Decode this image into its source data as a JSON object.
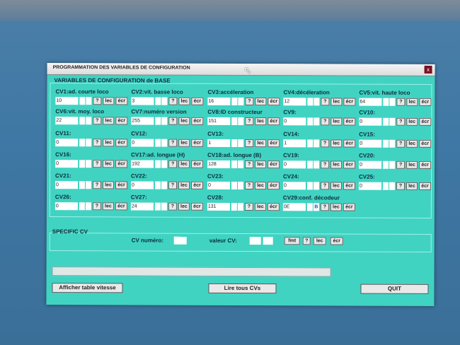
{
  "window": {
    "title": "PROGRAMMATION DES VARIABLES DE CONFIGURATION",
    "close_label": "x"
  },
  "base_section": {
    "title": "VARIABLES DE CONFIGURATION de BASE"
  },
  "buttons": {
    "q": "?",
    "lec": "lec",
    "ecr": "écr"
  },
  "cvs": [
    {
      "label": "CV1:ad. courte loco",
      "value": "10"
    },
    {
      "label": "CV2:vit. basse loco",
      "value": "3"
    },
    {
      "label": "CV3:accéleration",
      "value": "16"
    },
    {
      "label": "CV4:décéleration",
      "value": "12"
    },
    {
      "label": "CV5:vit. haute loco",
      "value": "64"
    },
    {
      "label": "CV6:vit. moy. loco",
      "value": "22"
    },
    {
      "label": "CV7:numéro version",
      "value": "255"
    },
    {
      "label": "CV8:ID constructeur",
      "value": "151"
    },
    {
      "label": "CV9:",
      "value": "0"
    },
    {
      "label": "CV10:",
      "value": "0"
    },
    {
      "label": "CV11:",
      "value": "0"
    },
    {
      "label": "CV12:",
      "value": "0"
    },
    {
      "label": "CV13:",
      "value": "1"
    },
    {
      "label": "CV14:",
      "value": "1"
    },
    {
      "label": "CV15:",
      "value": "0"
    },
    {
      "label": "CV16:",
      "value": "0"
    },
    {
      "label": "CV17:ad. longue (H)",
      "value": "192"
    },
    {
      "label": "CV18:ad. longue (B)",
      "value": "128"
    },
    {
      "label": "CV19:",
      "value": "0"
    },
    {
      "label": "CV20:",
      "value": "0"
    },
    {
      "label": "CV21:",
      "value": "0"
    },
    {
      "label": "CV22:",
      "value": "0"
    },
    {
      "label": "CV23:",
      "value": "0"
    },
    {
      "label": "CV24:",
      "value": "0"
    },
    {
      "label": "CV25:",
      "value": "0"
    },
    {
      "label": "CV26:",
      "value": "0"
    },
    {
      "label": "CV27:",
      "value": "24"
    },
    {
      "label": "CV28:",
      "value": "131"
    },
    {
      "label": "CV29:conf. décodeur",
      "value": "0E",
      "hex": "B"
    }
  ],
  "specific": {
    "title": "SPECIFIC CV",
    "cv_numero_label": "CV numéro:",
    "valeur_label": "valeur CV:",
    "fmt": "fmt",
    "q": "?",
    "lec": "lec",
    "ecr": "écr"
  },
  "bottom": {
    "table_vitesse": "Afficher table vitesse",
    "lire_tous": "Lire tous CVs",
    "quit": "QUIT"
  }
}
